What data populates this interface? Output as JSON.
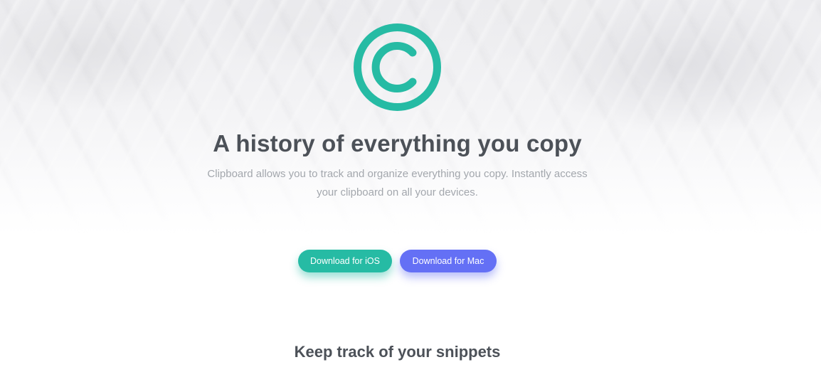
{
  "hero": {
    "logo_icon": "copyright-icon",
    "title": "A history of everything you copy",
    "description": "Clipboard allows you to track and organize everything you copy. Instantly access your clipboard on all your devices."
  },
  "actions": {
    "ios_label": "Download for iOS",
    "mac_label": "Download for Mac"
  },
  "section": {
    "title": "Keep track of your snippets"
  },
  "colors": {
    "accent_teal": "#26bba4",
    "accent_blue": "#6470f5",
    "heading": "#4c5158",
    "body_text": "#a3a7ad"
  }
}
